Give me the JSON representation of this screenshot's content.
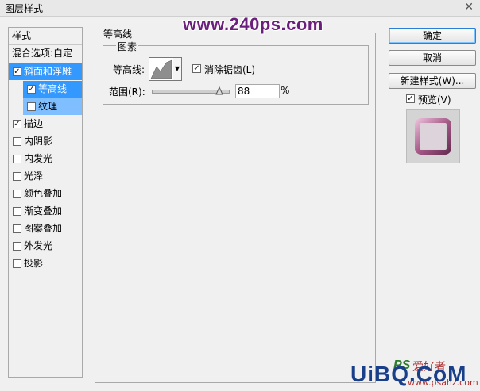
{
  "window": {
    "title": "图层样式",
    "close_icon": "close-icon"
  },
  "watermark": {
    "text": "www.240ps.com"
  },
  "left_panel": {
    "header": "样式",
    "blend_label": "混合选项:自定",
    "items": [
      {
        "label": "斜面和浮雕",
        "checked": true,
        "selected": true,
        "sub": false
      },
      {
        "label": "等高线",
        "checked": true,
        "selected": true,
        "sub": true
      },
      {
        "label": "纹理",
        "checked": false,
        "selected": true,
        "sub": true
      },
      {
        "label": "描边",
        "checked": true,
        "selected": false,
        "sub": false
      },
      {
        "label": "内阴影",
        "checked": false,
        "selected": false,
        "sub": false
      },
      {
        "label": "内发光",
        "checked": false,
        "selected": false,
        "sub": false
      },
      {
        "label": "光泽",
        "checked": false,
        "selected": false,
        "sub": false
      },
      {
        "label": "颜色叠加",
        "checked": false,
        "selected": false,
        "sub": false
      },
      {
        "label": "渐变叠加",
        "checked": false,
        "selected": false,
        "sub": false
      },
      {
        "label": "图案叠加",
        "checked": false,
        "selected": false,
        "sub": false
      },
      {
        "label": "外发光",
        "checked": false,
        "selected": false,
        "sub": false
      },
      {
        "label": "投影",
        "checked": false,
        "selected": false,
        "sub": false
      }
    ]
  },
  "contour_section": {
    "title": "等高线",
    "group_title": "图素",
    "contour_label": "等高线:",
    "antialias_label": "消除锯齿(L)",
    "antialias_checked": true,
    "range_label": "范围(R):",
    "range_value": "88",
    "range_unit": "%",
    "range_fraction": 0.88
  },
  "buttons": {
    "ok": "确定",
    "cancel": "取消",
    "new_style": "新建样式(W)...",
    "preview_label": "预览(V)",
    "preview_checked": true
  },
  "footer_watermark": {
    "ps": "PS",
    "cn": "爱好者",
    "big": "UiBQ.CoM",
    "small": "www.psahz.com"
  },
  "colors": {
    "selection": "#3399ff",
    "accent_button_border": "#2a7ed6",
    "watermark": "#6b1f7c"
  }
}
